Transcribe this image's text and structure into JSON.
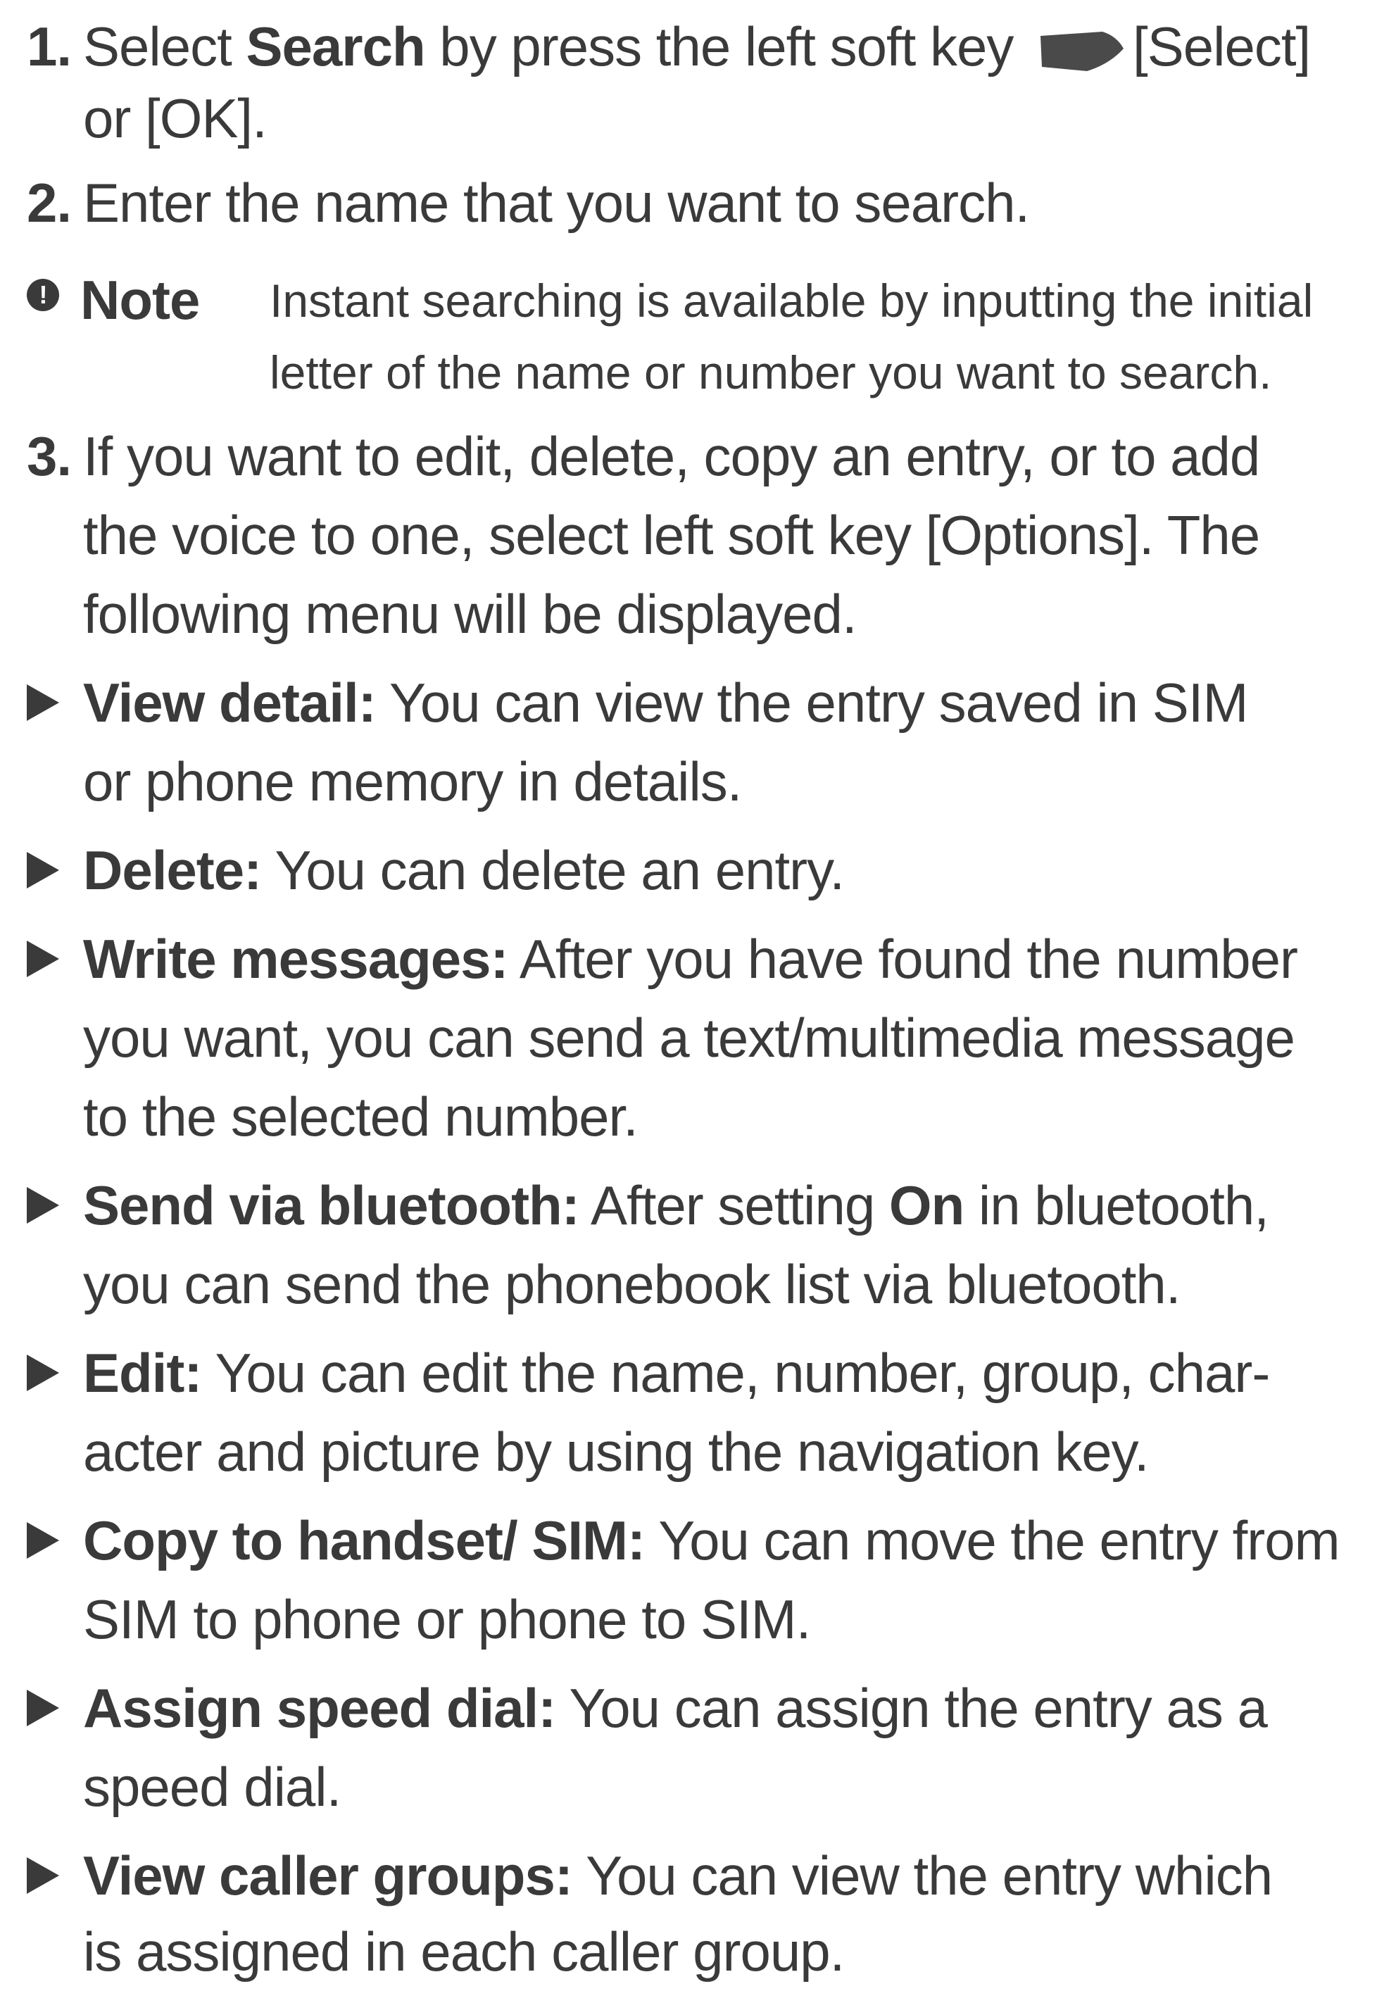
{
  "step1": {
    "number": "1.",
    "pre": "Select ",
    "bold": "Search",
    "post": " by press the left soft key ",
    "icon": "left-soft-key-icon",
    "after_icon": "[Select]",
    "line2": "or [OK]."
  },
  "step2": {
    "number": "2.",
    "text": "Enter the name that you want to search."
  },
  "note": {
    "icon": "!",
    "label": "Note",
    "line1": "Instant searching is available by inputting the initial",
    "line2": "letter of the name or number you want to search."
  },
  "step3": {
    "number": "3.",
    "line1": "If you want to edit, delete, copy an entry, or to add",
    "line2": "the voice to one, select left soft key  [Options]. The",
    "line3": "following menu will be displayed."
  },
  "options": [
    {
      "term": "View detail:",
      "line1": " You can view the entry saved in SIM",
      "line2": "or phone memory in details."
    },
    {
      "term": "Delete:",
      "line1": " You can delete an entry."
    },
    {
      "term": "Write messages:",
      "line1": " After you have found the number",
      "line2": "you want, you can send a text/multimedia message",
      "line3": "to the selected number."
    },
    {
      "term": "Send via bluetooth:",
      "line1_a": " After setting ",
      "line1_bold": "On",
      "line1_b": " in bluetooth,",
      "line2": "you can send the phonebook list via bluetooth."
    },
    {
      "term": "Edit:",
      "line1": " You can edit the name, number, group, char-",
      "line2": "acter and picture by using the navigation key."
    },
    {
      "term": "Copy to handset/ SIM:",
      "line1": " You can move the entry from",
      "line2": "SIM to phone or phone to SIM."
    },
    {
      "term": "Assign speed dial:",
      "line1": " You can assign the entry as a",
      "line2": "speed dial."
    },
    {
      "term": "View caller groups:",
      "line1": " You can view the entry which",
      "line2": "is assigned in each caller group."
    }
  ],
  "colors": {
    "text": "#3a3a3a",
    "background": "#ffffff"
  }
}
